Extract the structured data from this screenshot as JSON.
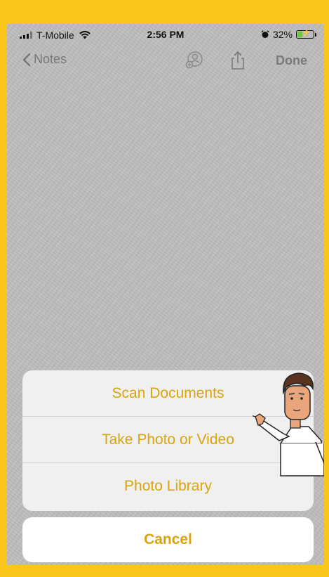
{
  "status_bar": {
    "carrier": "T-Mobile",
    "time": "2:56 PM",
    "battery_percent": "32%",
    "battery_level": 0.32,
    "battery_color": "#6cc644",
    "icons": [
      "signal-icon",
      "wifi-icon",
      "alarm-icon",
      "battery-icon"
    ]
  },
  "nav": {
    "back_label": "Notes",
    "done_label": "Done",
    "icons": [
      "add-person-icon",
      "share-icon"
    ]
  },
  "action_sheet": {
    "options": [
      "Scan Documents",
      "Take Photo or Video",
      "Photo Library"
    ],
    "cancel_label": "Cancel"
  },
  "colors": {
    "frame": "#fbc61c",
    "accent": "#d9a50f",
    "screen_bg": "#bdbdbd",
    "sheet_bg": "#f0f0f0"
  }
}
